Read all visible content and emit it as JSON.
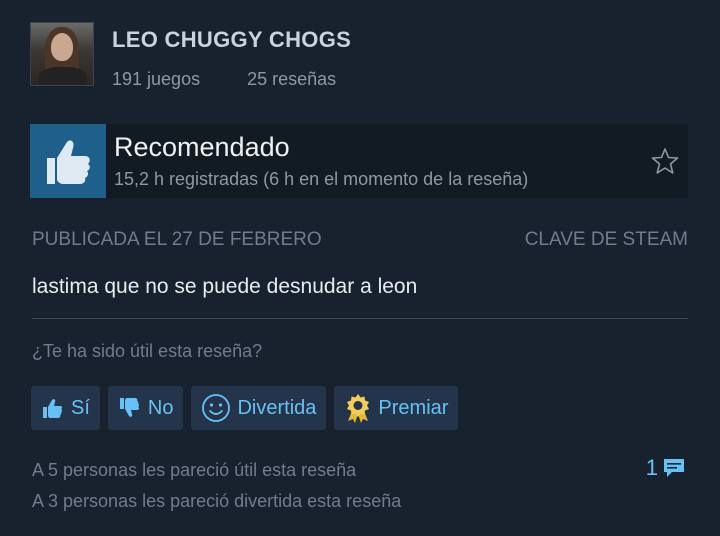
{
  "user": {
    "name": "LEO CHUGGY CHOGS",
    "games": "191 juegos",
    "reviews": "25 reseñas"
  },
  "recommendation": {
    "title": "Recomendado",
    "hours": "15,2 h registradas (6 h en el momento de la reseña)"
  },
  "review": {
    "posted": "PUBLICADA EL 27 DE FEBRERO",
    "source": "CLAVE DE STEAM",
    "text": "lastima que no se puede desnudar a leon"
  },
  "feedback": {
    "question": "¿Te ha sido útil esta reseña?",
    "buttons": {
      "yes": "Sí",
      "no": "No",
      "funny": "Divertida",
      "award": "Premiar"
    },
    "helpful_count": "A 5 personas les pareció útil esta reseña",
    "funny_count": "A 3 personas les pareció divertida esta reseña",
    "comments": "1"
  },
  "colors": {
    "background": "#18212e",
    "thumb_tile": "#1f5f8c",
    "link_blue": "#67c1f5",
    "button_bg": "#24344a"
  }
}
